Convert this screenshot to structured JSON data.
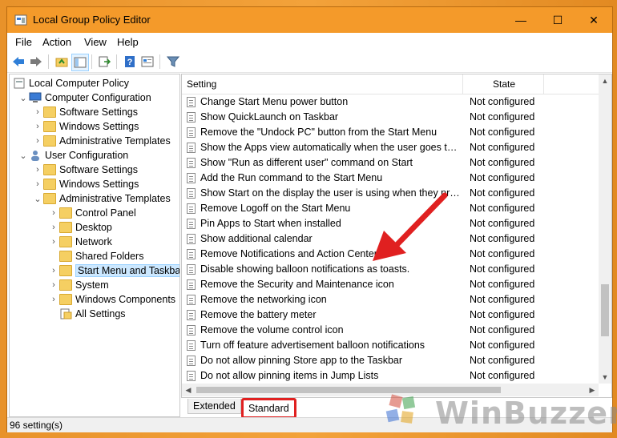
{
  "window": {
    "title": "Local Group Policy Editor",
    "controls": {
      "minimize": "—",
      "maximize": "☐",
      "close": "✕"
    }
  },
  "menu": [
    {
      "label": "File"
    },
    {
      "label": "Action"
    },
    {
      "label": "View"
    },
    {
      "label": "Help"
    }
  ],
  "toolbar": [
    "back-icon",
    "forward-icon",
    "up-folder-icon",
    "show-hide-tree-icon",
    "export-list-icon",
    "help-icon",
    "properties-icon",
    "filter-icon"
  ],
  "tree": {
    "root": "Local Computer Policy",
    "computer_config": "Computer Configuration",
    "cc_software": "Software Settings",
    "cc_windows": "Windows Settings",
    "cc_admin": "Administrative Templates",
    "user_config": "User Configuration",
    "uc_software": "Software Settings",
    "uc_windows": "Windows Settings",
    "uc_admin": "Administrative Templates",
    "control_panel": "Control Panel",
    "desktop": "Desktop",
    "network": "Network",
    "shared_folders": "Shared Folders",
    "start_menu": "Start Menu and Taskbar",
    "system": "System",
    "windows_components": "Windows Components",
    "all_settings": "All Settings"
  },
  "list": {
    "col_setting": "Setting",
    "col_state": "State",
    "rows": [
      {
        "name": "Change Start Menu power button",
        "state": "Not configured"
      },
      {
        "name": "Show QuickLaunch on Taskbar",
        "state": "Not configured"
      },
      {
        "name": "Remove the \"Undock PC\" button from the Start Menu",
        "state": "Not configured"
      },
      {
        "name": "Show the Apps view automatically when the user goes to Start",
        "state": "Not configured"
      },
      {
        "name": "Show \"Run as different user\" command on Start",
        "state": "Not configured"
      },
      {
        "name": "Add the Run command to the Start Menu",
        "state": "Not configured"
      },
      {
        "name": "Show Start on the display the user is using when they press the Windows logo key",
        "state": "Not configured"
      },
      {
        "name": "Remove Logoff on the Start Menu",
        "state": "Not configured"
      },
      {
        "name": "Pin Apps to Start when installed",
        "state": "Not configured"
      },
      {
        "name": "Show additional calendar",
        "state": "Not configured"
      },
      {
        "name": "Remove Notifications and Action Center",
        "state": "Not configured"
      },
      {
        "name": "Disable showing balloon notifications as toasts.",
        "state": "Not configured"
      },
      {
        "name": "Remove the Security and Maintenance icon",
        "state": "Not configured"
      },
      {
        "name": "Remove the networking icon",
        "state": "Not configured"
      },
      {
        "name": "Remove the battery meter",
        "state": "Not configured"
      },
      {
        "name": "Remove the volume control icon",
        "state": "Not configured"
      },
      {
        "name": "Turn off feature advertisement balloon notifications",
        "state": "Not configured"
      },
      {
        "name": "Do not allow pinning Store app to the Taskbar",
        "state": "Not configured"
      },
      {
        "name": "Do not allow pinning items in Jump Lists",
        "state": "Not configured"
      }
    ]
  },
  "tabs": {
    "extended": "Extended",
    "standard": "Standard"
  },
  "status": "96 setting(s)",
  "watermark": "WinBuzzer",
  "colors": {
    "titlebar": "#f49a2a",
    "annotation": "#e02020",
    "selection": "#cce8ff"
  }
}
